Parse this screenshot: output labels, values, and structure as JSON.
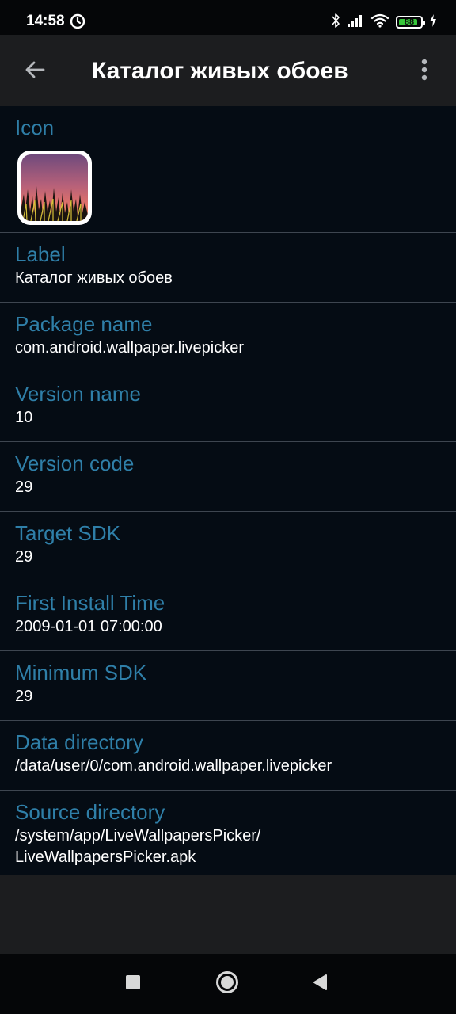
{
  "status_bar": {
    "time": "14:58",
    "battery_level": "88",
    "battery_fraction": 0.88,
    "icons": [
      "alarm-icon",
      "bluetooth-icon",
      "signal-icon",
      "wifi-icon",
      "battery-icon",
      "charging-icon"
    ]
  },
  "app_bar": {
    "title": "Каталог живых обоев",
    "back_icon": "arrow-left-icon",
    "more_icon": "more-vert-icon"
  },
  "details": {
    "icon_label": "Icon",
    "rows": [
      {
        "label": "Label",
        "value": "Каталог живых обоев"
      },
      {
        "label": "Package name",
        "value": "com.android.wallpaper.livepicker"
      },
      {
        "label": "Version name",
        "value": "10"
      },
      {
        "label": "Version code",
        "value": "29"
      },
      {
        "label": "Target SDK",
        "value": "29"
      },
      {
        "label": "First Install Time",
        "value": "2009-01-01 07:00:00"
      },
      {
        "label": "Minimum SDK",
        "value": "29"
      },
      {
        "label": "Data directory",
        "value": "/data/user/0/com.android.wallpaper.livepicker"
      },
      {
        "label": "Source directory",
        "value": "/system/app/LiveWallpapersPicker/\nLiveWallpapersPicker.apk"
      }
    ]
  },
  "nav_bar": {
    "icons": [
      "recents-square-icon",
      "home-circle-icon",
      "back-triangle-icon"
    ]
  },
  "colors": {
    "label_accent": "#2f7fa8",
    "content_background": "#050c14",
    "toolbar_background": "#1c1d1f",
    "battery_green": "#37c73a"
  }
}
